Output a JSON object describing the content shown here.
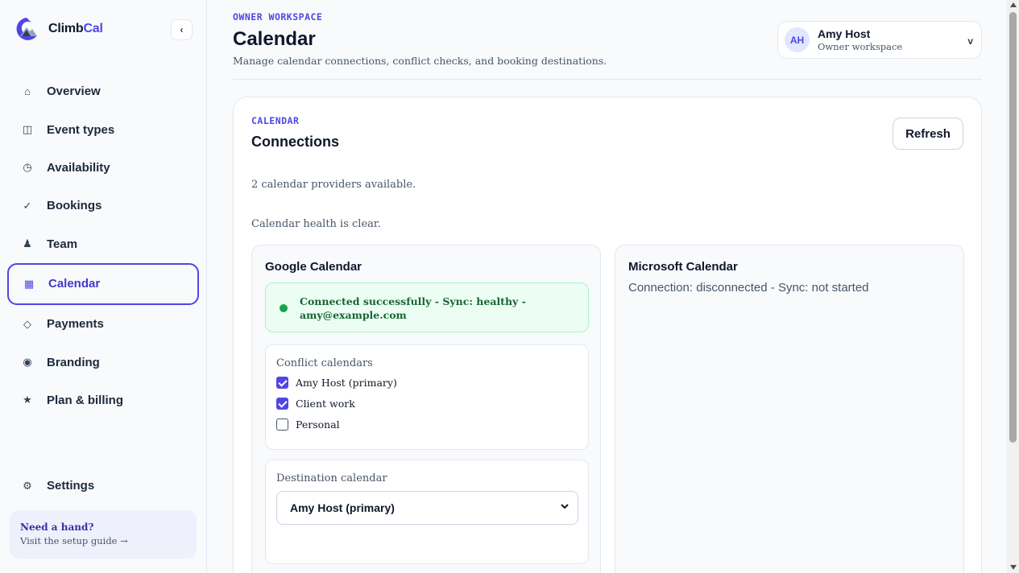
{
  "app": {
    "name_main": "Climb",
    "name_accent": "Cal"
  },
  "sidebar": {
    "collapse_icon": "‹",
    "items": [
      {
        "label": "Overview",
        "icon": "⌂"
      },
      {
        "label": "Event types",
        "icon": "◫"
      },
      {
        "label": "Availability",
        "icon": "◷"
      },
      {
        "label": "Bookings",
        "icon": "✓"
      },
      {
        "label": "Team",
        "icon": "♟"
      },
      {
        "label": "Calendar",
        "icon": "▦"
      },
      {
        "label": "Payments",
        "icon": "◇"
      },
      {
        "label": "Branding",
        "icon": "◉"
      },
      {
        "label": "Plan & billing",
        "icon": "★"
      }
    ],
    "settings": {
      "label": "Settings",
      "icon": "⚙"
    },
    "help": {
      "title": "Need a hand?",
      "subtitle": "Visit the setup guide →"
    }
  },
  "header": {
    "eyebrow": "OWNER WORKSPACE",
    "title": "Calendar",
    "subtitle": "Manage calendar connections, conflict checks, and booking destinations.",
    "user": {
      "initials": "AH",
      "name": "Amy Host",
      "role": "Owner workspace",
      "chevron": "v"
    }
  },
  "card": {
    "eyebrow": "CALENDAR",
    "title": "Connections",
    "refresh_label": "Refresh",
    "providers_text": "2 calendar providers available.",
    "health_text": "Calendar health is clear.",
    "google": {
      "title": "Google Calendar",
      "status": "Connected successfully - Sync: healthy - amy@example.com",
      "conflict_label": "Conflict calendars",
      "conflict_calendars": [
        {
          "label": "Amy Host (primary)",
          "checked": true
        },
        {
          "label": "Client work",
          "checked": true
        },
        {
          "label": "Personal",
          "checked": false
        }
      ],
      "destination_label": "Destination calendar",
      "destination_value": "Amy Host (primary)"
    },
    "microsoft": {
      "title": "Microsoft Calendar",
      "status": "Connection: disconnected - Sync: not started"
    }
  },
  "colors": {
    "accent": "#4f46e5",
    "success_bg": "#ecfdf3",
    "success_text": "#166534"
  }
}
